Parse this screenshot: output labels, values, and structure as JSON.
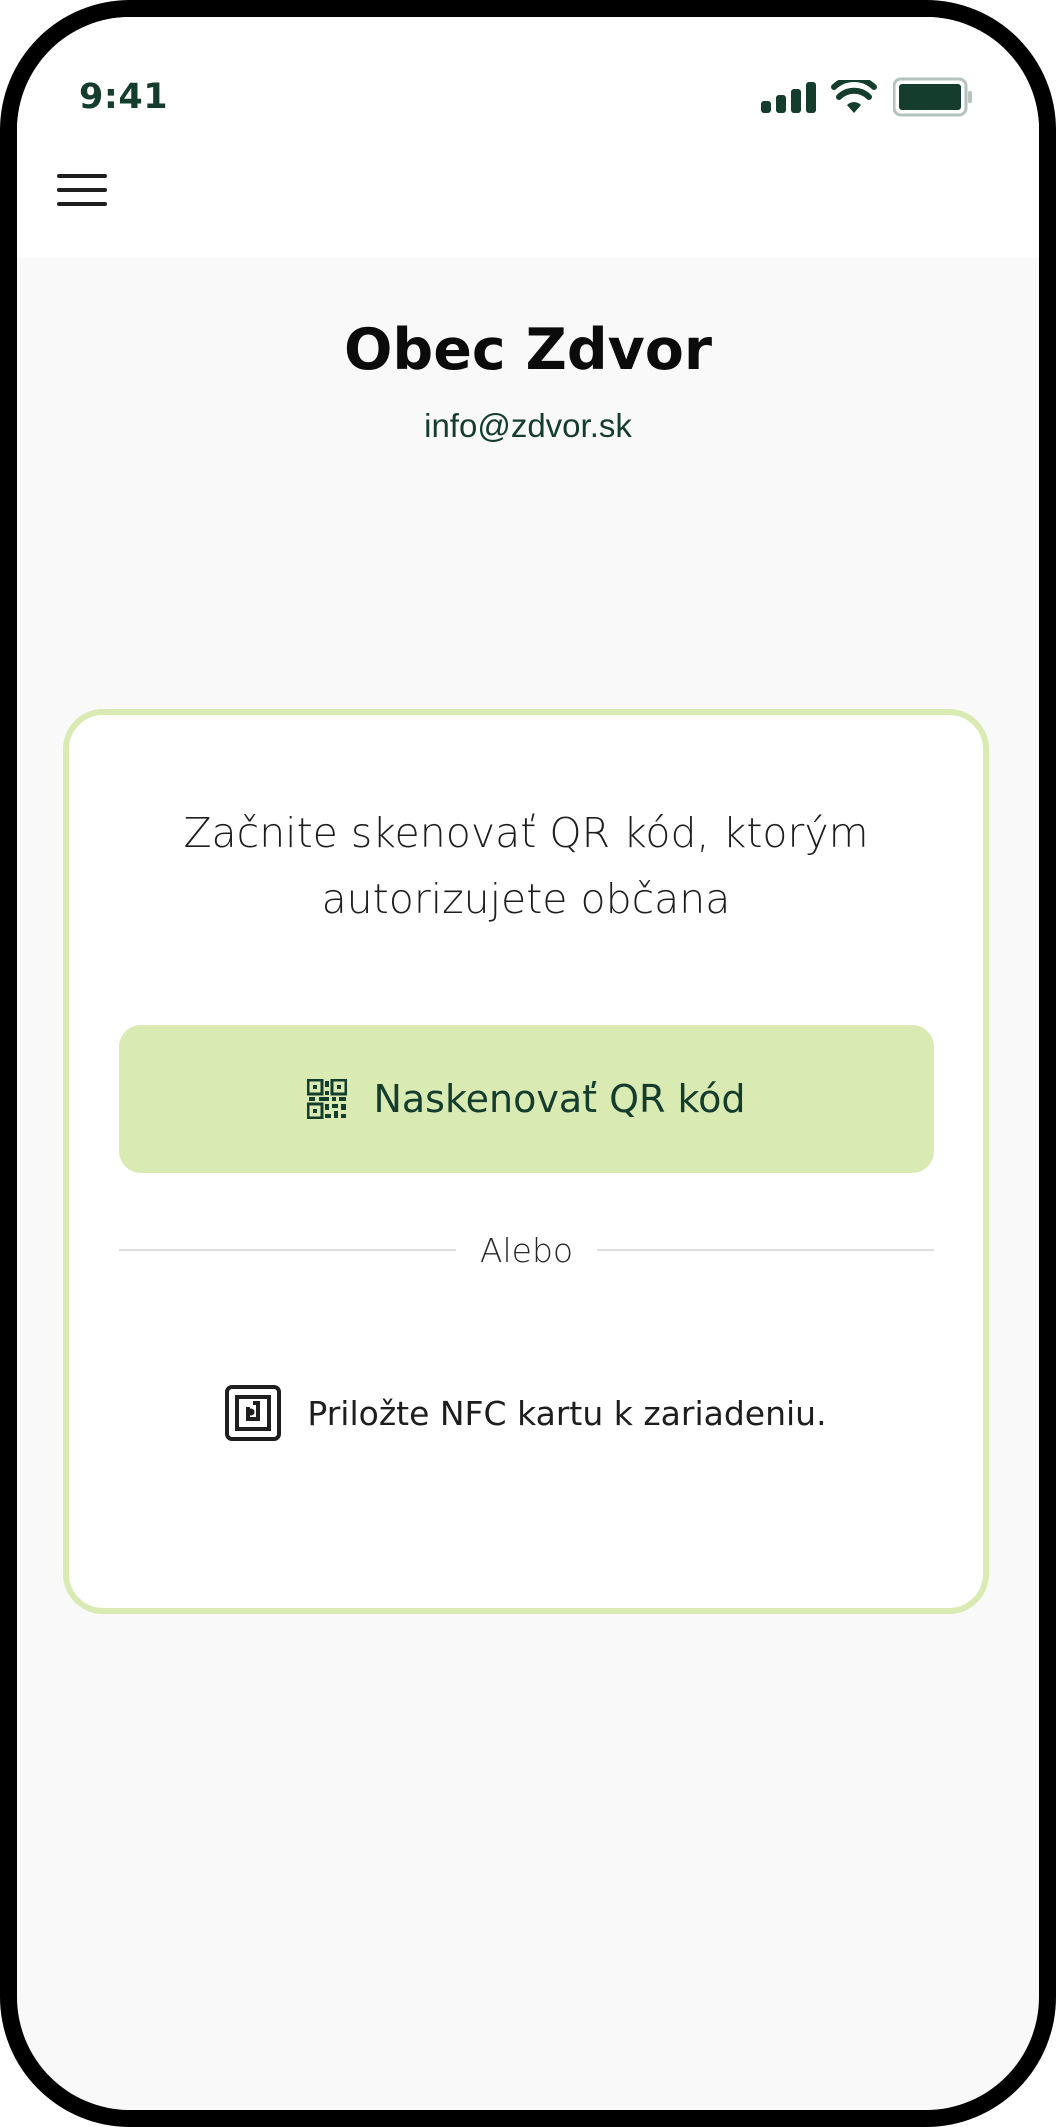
{
  "status_bar": {
    "time": "9:41"
  },
  "header": {
    "menu_icon": "hamburger-menu-icon"
  },
  "organization": {
    "name": "Obec Zdvor",
    "email": "info@zdvor.sk"
  },
  "auth_card": {
    "instruction": "Začnite skenovať QR kód, ktorým autorizujete občana",
    "scan_button_label": "Naskenovať QR kód",
    "scan_button_icon": "qr-code-icon",
    "divider_text": "Alebo",
    "nfc_text": "Priložte NFC kartu k zariadeniu.",
    "nfc_icon": "nfc-icon"
  },
  "colors": {
    "accent_green": "#d9eab3",
    "dark_green_text": "#143d2e",
    "background": "#f9f9f9"
  }
}
